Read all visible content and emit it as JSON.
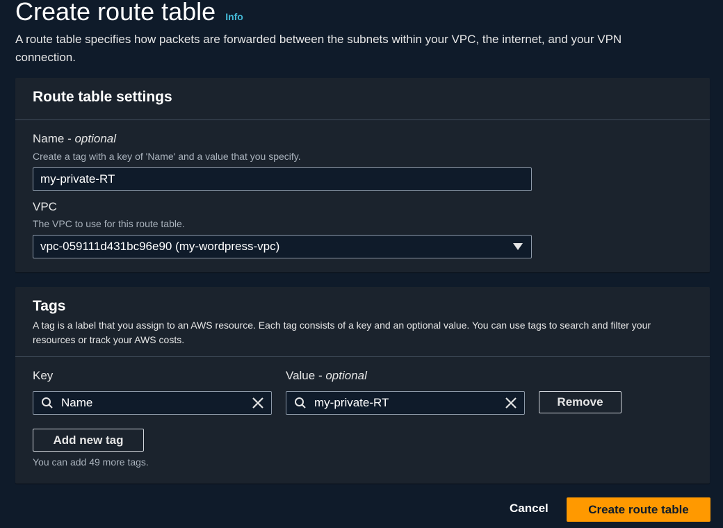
{
  "header": {
    "title": "Create route table",
    "info_link": "Info",
    "description": "A route table specifies how packets are forwarded between the subnets within your VPC, the internet, and your VPN connection."
  },
  "settings": {
    "title": "Route table settings",
    "name_label": "Name - ",
    "name_optional": "optional",
    "name_desc": "Create a tag with a key of 'Name' and a value that you specify.",
    "name_value": "my-private-RT",
    "vpc_label": "VPC",
    "vpc_desc": "The VPC to use for this route table.",
    "vpc_value": "vpc-059111d431bc96e90 (my-wordpress-vpc)"
  },
  "tags": {
    "title": "Tags",
    "description": "A tag is a label that you assign to an AWS resource. Each tag consists of a key and an optional value. You can use tags to search and filter your resources or track your AWS costs.",
    "key_label": "Key",
    "value_label": "Value - ",
    "value_optional": "optional",
    "rows": [
      {
        "key": "Name",
        "value": "my-private-RT",
        "remove_label": "Remove"
      }
    ],
    "add_button": "Add new tag",
    "hint": "You can add 49 more tags."
  },
  "footer": {
    "cancel": "Cancel",
    "submit": "Create route table"
  },
  "colors": {
    "background": "#0f1b2a",
    "panel": "#1b232d",
    "primary": "#ff9900",
    "link": "#44b9d6"
  }
}
